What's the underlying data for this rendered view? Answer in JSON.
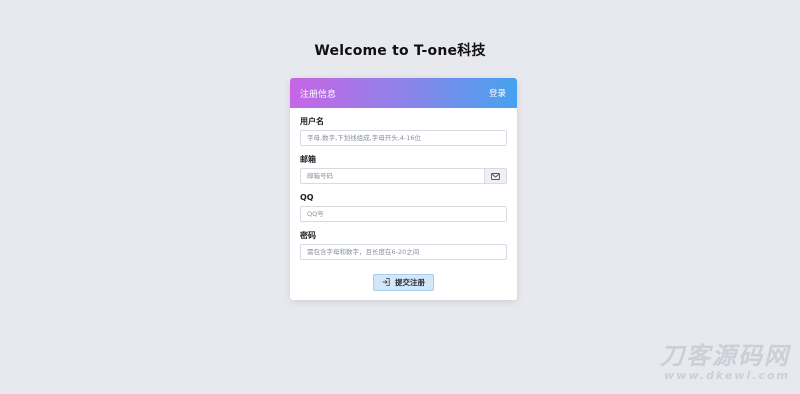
{
  "page": {
    "title": "Welcome to T-one科技"
  },
  "card": {
    "header_title": "注册信息",
    "login_link": "登录"
  },
  "form": {
    "username": {
      "label": "用户名",
      "placeholder": "字母,数字,下划线组成,字母开头,4-16位",
      "value": ""
    },
    "email": {
      "label": "邮箱",
      "placeholder": "邮箱号码",
      "value": "",
      "addon_icon": "envelope-icon"
    },
    "qq": {
      "label": "QQ",
      "placeholder": "QQ号",
      "value": ""
    },
    "password": {
      "label": "密码",
      "placeholder": "需包含字母和数字，且长度在6-20之间",
      "value": ""
    },
    "submit": {
      "label": "提交注册",
      "icon": "sign-in-icon"
    }
  },
  "watermark": {
    "main": "刀客源码网",
    "url": "www.dkewl.com"
  },
  "colors": {
    "background": "#e7e9ef",
    "header_gradient_start": "#c765e6",
    "header_gradient_end": "#46a2ef",
    "submit_bg": "#d3e7f9"
  }
}
